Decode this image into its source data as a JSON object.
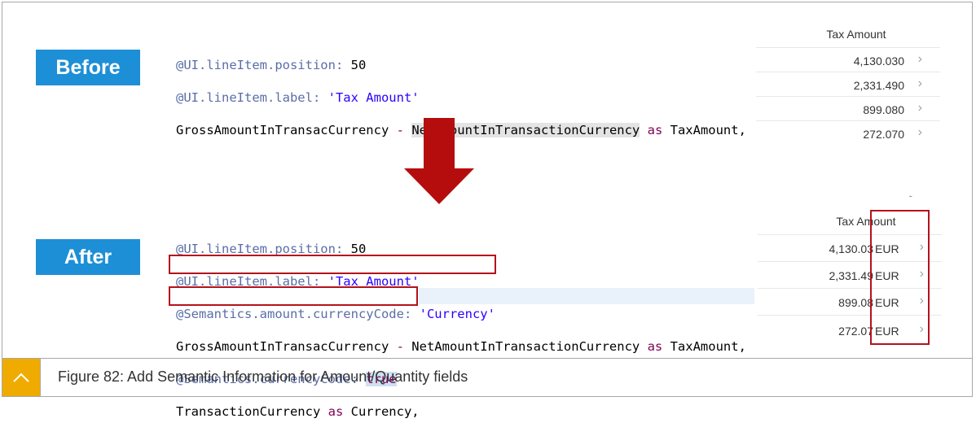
{
  "labels": {
    "before": "Before",
    "after": "After"
  },
  "before_code": {
    "line1_ann": "@UI.lineItem.position:",
    "line1_val": " 50",
    "line2_ann": "@UI.lineItem.label:",
    "line2_str": " 'Tax Amount'",
    "line3_a": "GrossAmountInTransacCurrency ",
    "line3_op": "-",
    "line3_b": " ",
    "line3_hl": "NetAmountInTransactionCurrency",
    "line3_kw": " as",
    "line3_c": " TaxAmount,"
  },
  "after_code": {
    "line1_ann": "@UI.lineItem.position:",
    "line1_val": " 50",
    "line2_ann": "@UI.lineItem.label:",
    "line2_str": " 'Tax Amount'",
    "line3_ann": "@Semantics.amount.currencyCode:",
    "line3_str": " 'Currency'",
    "line4_a": "GrossAmountInTransacCurrency ",
    "line4_op": "-",
    "line4_b": " NetAmountInTransactionCurrency",
    "line4_kw": " as",
    "line4_c": " TaxAmount,",
    "line5_ann": "@Semantics.currencyCode:",
    "line5_sp": " ",
    "line5_true": "true",
    "line6_a": "TransactionCurrency",
    "line6_kw": " as",
    "line6_c": " Currency,"
  },
  "table_before": {
    "header": "Tax Amount",
    "rows": [
      {
        "amount": "4,130.030"
      },
      {
        "amount": "2,331.490"
      },
      {
        "amount": "899.080"
      },
      {
        "amount": "272.070"
      }
    ]
  },
  "table_after": {
    "header": "Tax Amount",
    "dash": "-",
    "rows": [
      {
        "amount": "4,130.03",
        "currency": "EUR"
      },
      {
        "amount": "2,331.49",
        "currency": "EUR"
      },
      {
        "amount": "899.08",
        "currency": "EUR"
      },
      {
        "amount": "272.07",
        "currency": "EUR"
      }
    ]
  },
  "chevron": "›",
  "arrow_icon": "down-arrow-icon",
  "caption": "Figure 82: Add Semantic Information for Amount/Quantity fields",
  "colors": {
    "accent_blue": "#1d8fd6",
    "highlight_red": "#b5121b",
    "arrow_red": "#b50d0d",
    "footer_yellow": "#f0ab00"
  }
}
